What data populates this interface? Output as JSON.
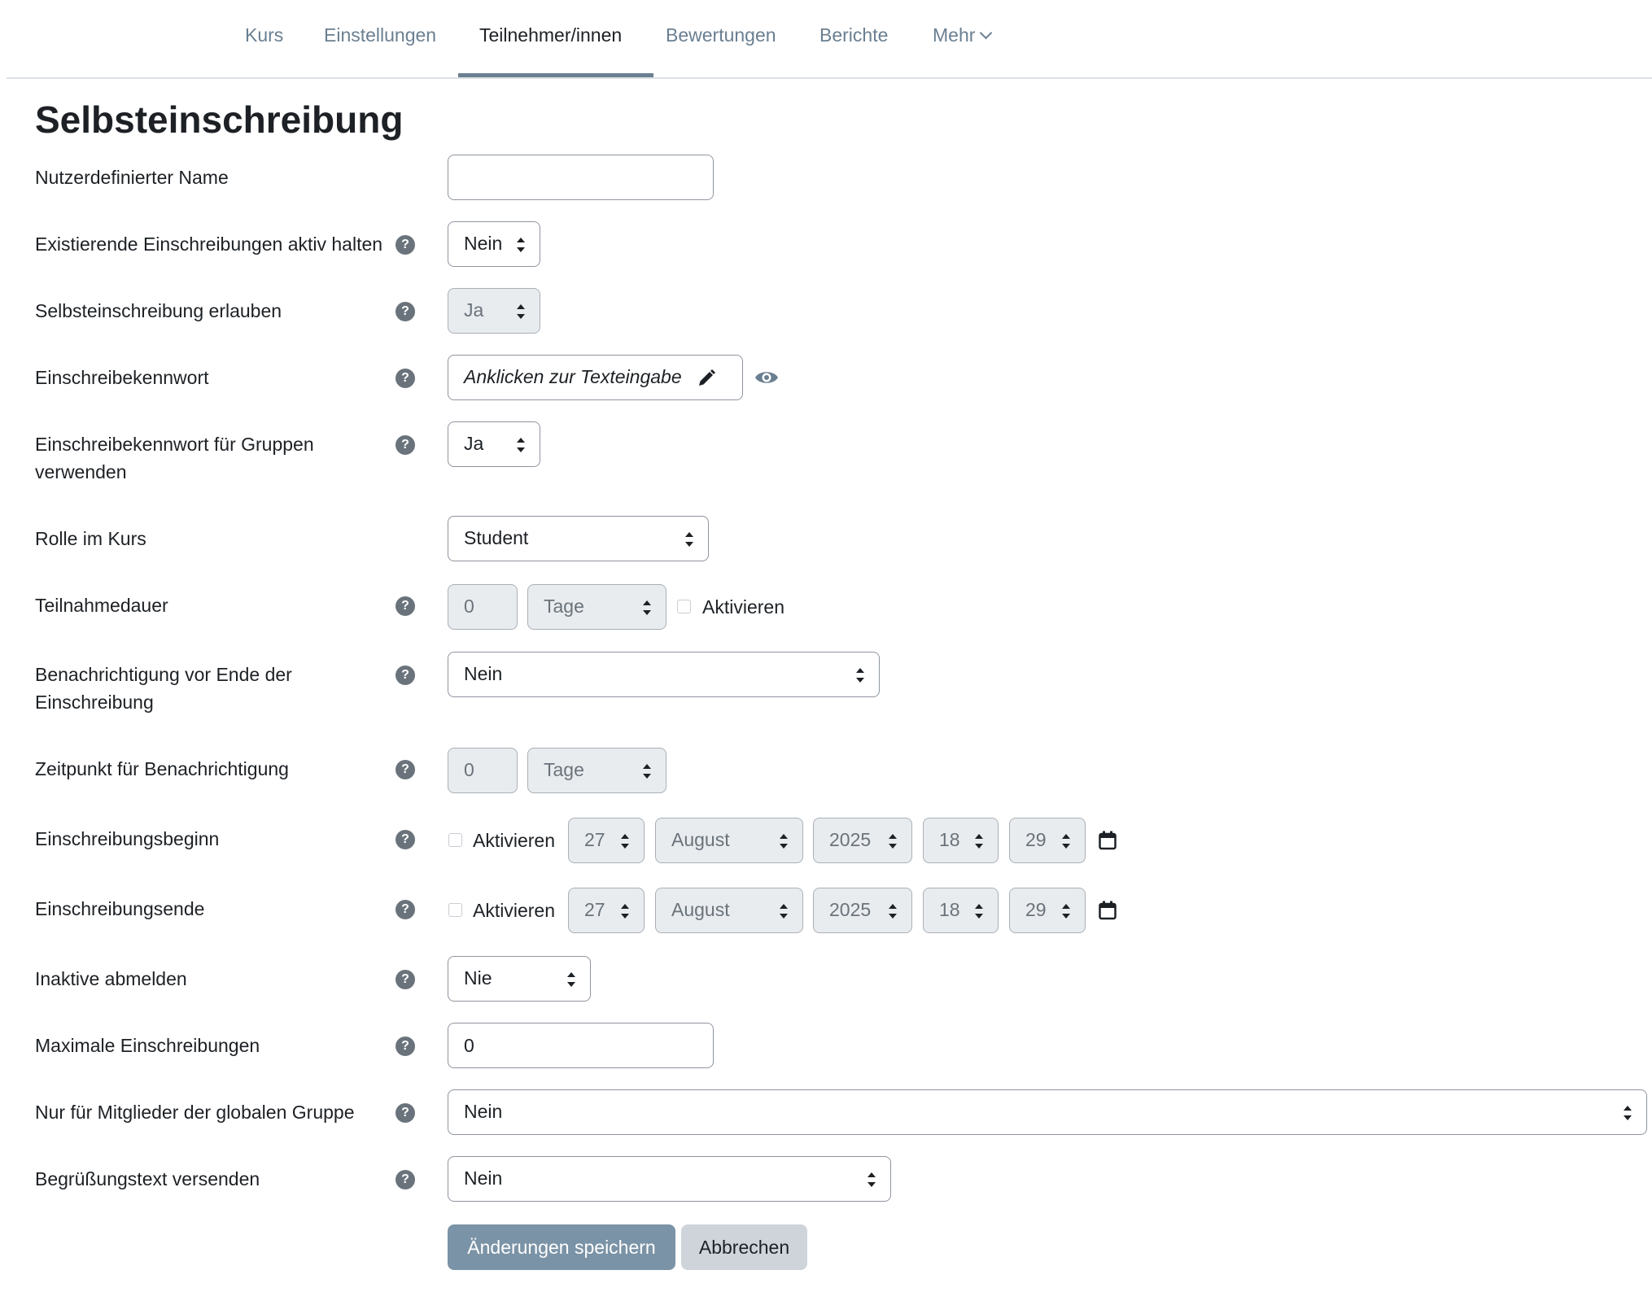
{
  "nav": {
    "tabs": [
      {
        "label": "Kurs"
      },
      {
        "label": "Einstellungen"
      },
      {
        "label": "Teilnehmer/innen",
        "active": true
      },
      {
        "label": "Bewertungen"
      },
      {
        "label": "Berichte"
      },
      {
        "label": "Mehr"
      }
    ]
  },
  "page": {
    "title": "Selbsteinschreibung"
  },
  "form": {
    "custom_name": {
      "label": "Nutzerdefinierter Name",
      "value": ""
    },
    "keep_active": {
      "label": "Existierende Einschreibungen aktiv halten",
      "value": "Nein"
    },
    "allow_self": {
      "label": "Selbsteinschreibung erlauben",
      "value": "Ja"
    },
    "password": {
      "label": "Einschreibekennwort",
      "placeholder": "Anklicken zur Texteingabe"
    },
    "group_key": {
      "label_line1": "Einschreibekennwort für Gruppen",
      "label_line2": "verwenden",
      "value": "Ja"
    },
    "role": {
      "label": "Rolle im Kurs",
      "value": "Student"
    },
    "duration": {
      "label": "Teilnahmedauer",
      "number": "0",
      "unit": "Tage",
      "enable_label": "Aktivieren"
    },
    "expiry_notify": {
      "label_line1": "Benachrichtigung vor Ende der",
      "label_line2": "Einschreibung",
      "value": "Nein"
    },
    "notify_time": {
      "label": "Zeitpunkt für Benachrichtigung",
      "number": "0",
      "unit": "Tage"
    },
    "start": {
      "label": "Einschreibungsbeginn",
      "enable_label": "Aktivieren",
      "day": "27",
      "month": "August",
      "year": "2025",
      "hour": "18",
      "minute": "29"
    },
    "end": {
      "label": "Einschreibungsende",
      "enable_label": "Aktivieren",
      "day": "27",
      "month": "August",
      "year": "2025",
      "hour": "18",
      "minute": "29"
    },
    "unenrol_inactive": {
      "label": "Inaktive abmelden",
      "value": "Nie"
    },
    "max_enrolled": {
      "label": "Maximale Einschreibungen",
      "value": "0"
    },
    "cohort_only": {
      "label": "Nur für Mitglieder der globalen Gruppe",
      "value": "Nein"
    },
    "welcome": {
      "label": "Begrüßungstext versenden",
      "value": "Nein"
    }
  },
  "buttons": {
    "save": "Änderungen speichern",
    "cancel": "Abbrechen"
  },
  "help_glyph": "?"
}
